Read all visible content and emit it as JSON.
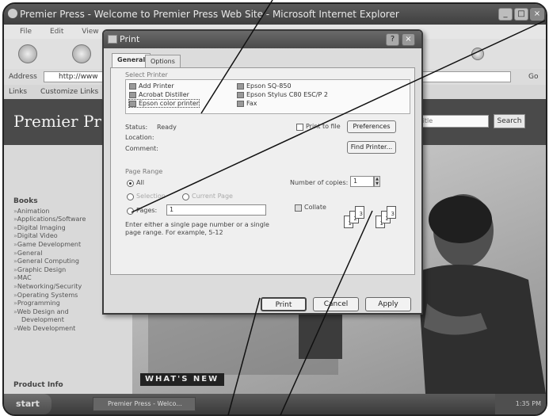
{
  "browser": {
    "title": "Premier Press - Welcome to Premier Press Web Site - Microsoft Internet Explorer",
    "menu": [
      "File",
      "Edit",
      "View"
    ],
    "address_label": "Address",
    "address_value": "http://www",
    "go_label": "Go",
    "links_label": "Links",
    "links_item": "Customize Links"
  },
  "page": {
    "banner_title": "Premier Press",
    "search_placeholder": "Title",
    "search_button": "Search",
    "books_header": "Books",
    "books": [
      "Animation",
      "Applications/Software",
      "Digital Imaging",
      "Digital Video",
      "Game Development",
      "General",
      "General Computing",
      "Graphic Design",
      "MAC",
      "Networking/Security",
      "Operating Systems",
      "Programming",
      "Web Design and",
      "Development",
      "Web Development"
    ],
    "product_info": "Product Info",
    "whats_new": "WHAT'S NEW"
  },
  "dialog": {
    "title": "Print",
    "tabs": [
      "General",
      "Options"
    ],
    "select_printer_label": "Select Printer",
    "printers": [
      "Add Printer",
      "Acrobat Distiller",
      "Epson color printer",
      "Epson SQ-850",
      "Epson Stylus C80 ESC/P 2",
      "Fax"
    ],
    "status_label": "Status:",
    "status_value": "Ready",
    "location_label": "Location:",
    "comment_label": "Comment:",
    "print_to_file_label": "Print to file",
    "preferences_button": "Preferences",
    "find_printer_button": "Find Printer...",
    "page_range_label": "Page Range",
    "all_label": "All",
    "selection_label": "Selection",
    "current_page_label": "Current Page",
    "pages_label": "Pages:",
    "pages_value": "1",
    "pages_hint": "Enter either a single page number or a single page range.  For example, 5-12",
    "copies_label": "Number of copies:",
    "copies_value": "1",
    "collate_label": "Collate",
    "collate_pages": [
      "1",
      "2",
      "3",
      "1",
      "2",
      "3"
    ],
    "print_button": "Print",
    "cancel_button": "Cancel",
    "apply_button": "Apply"
  },
  "taskbar": {
    "start_label": "start",
    "task_item": "Premier Press - Welco...",
    "clock": "1:35 PM"
  }
}
